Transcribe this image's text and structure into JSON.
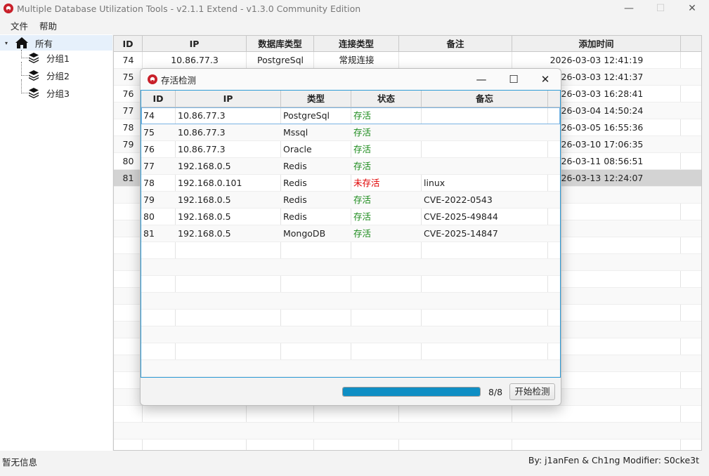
{
  "window": {
    "title": "Multiple Database Utilization Tools - v2.1.1 Extend - v1.3.0 Community Edition",
    "minimize_glyph": "—",
    "maximize_glyph": "☐",
    "close_glyph": "✕"
  },
  "menu": {
    "items": [
      "文件",
      "帮助"
    ]
  },
  "tree": {
    "root": "所有",
    "groups": [
      "分组1",
      "分组2",
      "分组3"
    ]
  },
  "main_table": {
    "columns": [
      "ID",
      "IP",
      "数据库类型",
      "连接类型",
      "备注",
      "添加时间"
    ],
    "rows": [
      {
        "id": "74",
        "ip": "10.86.77.3",
        "db": "PostgreSql",
        "conn": "常规连接",
        "note": "",
        "time": "2026-03-03 12:41:19"
      },
      {
        "id": "75",
        "time": "2026-03-03 12:41:37"
      },
      {
        "id": "76",
        "time": "2026-03-03 16:28:41"
      },
      {
        "id": "77",
        "time": "2026-03-04 14:50:24"
      },
      {
        "id": "78",
        "time": "2026-03-05 16:55:36"
      },
      {
        "id": "79",
        "time": "2026-03-10 17:06:35"
      },
      {
        "id": "80",
        "time": "2026-03-11 08:56:51"
      },
      {
        "id": "81",
        "time": "2026-03-13 12:24:07"
      }
    ]
  },
  "dialog": {
    "title": "存活检测",
    "columns": [
      "ID",
      "IP",
      "类型",
      "状态",
      "备忘"
    ],
    "rows": [
      {
        "id": "74",
        "ip": "10.86.77.3",
        "type": "PostgreSql",
        "status": "存活",
        "note": ""
      },
      {
        "id": "75",
        "ip": "10.86.77.3",
        "type": "Mssql",
        "status": "存活",
        "note": ""
      },
      {
        "id": "76",
        "ip": "10.86.77.3",
        "type": "Oracle",
        "status": "存活",
        "note": ""
      },
      {
        "id": "77",
        "ip": "192.168.0.5",
        "type": "Redis",
        "status": "存活",
        "note": ""
      },
      {
        "id": "78",
        "ip": "192.168.0.101",
        "type": "Redis",
        "status": "未存活",
        "note": "linux"
      },
      {
        "id": "79",
        "ip": "192.168.0.5",
        "type": "Redis",
        "status": "存活",
        "note": "CVE-2022-0543"
      },
      {
        "id": "80",
        "ip": "192.168.0.5",
        "type": "Redis",
        "status": "存活",
        "note": "CVE-2025-49844"
      },
      {
        "id": "81",
        "ip": "192.168.0.5",
        "type": "MongoDB",
        "status": "存活",
        "note": "CVE-2025-14847"
      }
    ],
    "progress_fraction": 1.0,
    "progress_text": "8/8",
    "start_button": "开始检测",
    "alive_color": "#1a8a1a",
    "dead_color": "#e00000"
  },
  "status": {
    "left": "暂无信息",
    "right": "By: j1anFen & Ch1ng Modifier: S0cke3t"
  }
}
